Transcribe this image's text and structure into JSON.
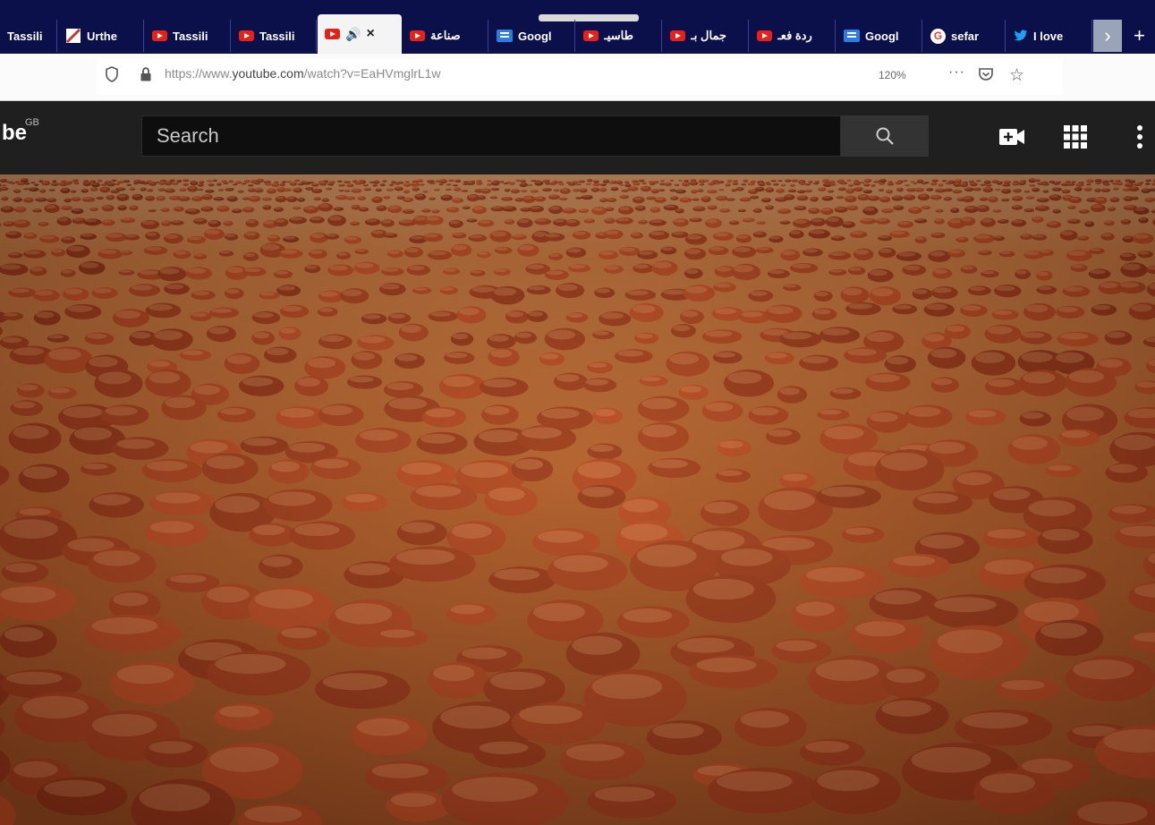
{
  "tabs": [
    {
      "label": "Tassili",
      "icon": "none",
      "active": false
    },
    {
      "label": "Urthe",
      "icon": "image-icon",
      "active": false
    },
    {
      "label": "Tassili",
      "icon": "youtube-icon",
      "active": false
    },
    {
      "label": "Tassili",
      "icon": "youtube-icon",
      "active": false
    },
    {
      "label": "",
      "icon": "youtube-icon",
      "active": true,
      "audio": "speaker-icon",
      "close": "×"
    },
    {
      "label": "صناعة",
      "icon": "youtube-icon",
      "active": false
    },
    {
      "label": "Googl",
      "icon": "google-docs-icon",
      "active": false
    },
    {
      "label": "طاسيـ",
      "icon": "youtube-icon",
      "active": false
    },
    {
      "label": "جمال بـ",
      "icon": "youtube-icon",
      "active": false
    },
    {
      "label": "ردة فعـ",
      "icon": "youtube-icon",
      "active": false
    },
    {
      "label": "Googl",
      "icon": "google-docs-icon",
      "active": false
    },
    {
      "label": "sefar",
      "icon": "google-icon",
      "active": false
    },
    {
      "label": "I love",
      "icon": "twitter-icon",
      "active": false
    }
  ],
  "tab_overflow": "›",
  "new_tab": "+",
  "address_bar": {
    "url_prefix": "https://www.",
    "url_domain": "youtube.com",
    "url_path": "/watch?v=EaHVmglrL1w",
    "zoom": "120%",
    "more": "···",
    "star": "☆"
  },
  "youtube": {
    "logo_fragment": "be",
    "region": "GB",
    "search_placeholder": "Search"
  },
  "colors": {
    "tab_strip": "#0b0f4a",
    "youtube_red": "#e62117",
    "header_bg": "#1f1f1f",
    "desert": "#a45a2c"
  }
}
